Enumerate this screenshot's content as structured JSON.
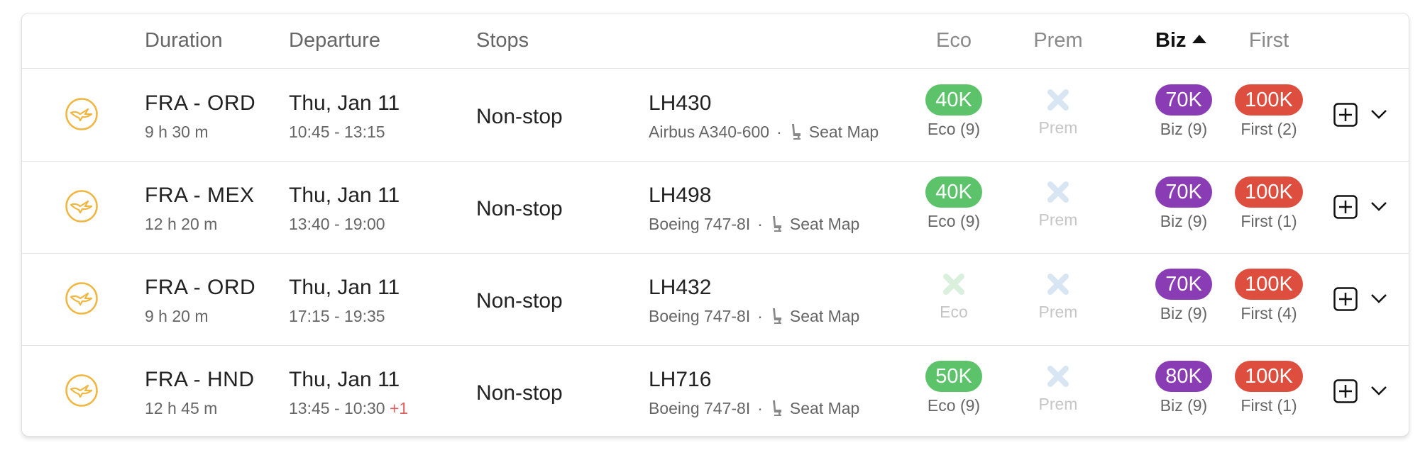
{
  "header": {
    "duration": "Duration",
    "departure": "Departure",
    "stops": "Stops",
    "eco": "Eco",
    "prem": "Prem",
    "biz": "Biz",
    "first": "First"
  },
  "colors": {
    "eco": "#5cc36b",
    "biz": "#8a3cb4",
    "first": "#de4e3e",
    "logo": "#f0b640",
    "unavailable": "#d7e6f2",
    "unavailable_eco": "#d9f0dc"
  },
  "icons": {
    "airline_logo": "lufthansa-crane-icon",
    "seat": "seat-icon",
    "add": "add-square-icon",
    "expand": "chevron-down-icon",
    "unavailable": "x-icon"
  },
  "flights": [
    {
      "route": "FRA - ORD",
      "duration": "9 h 30 m",
      "date": "Thu, Jan 11",
      "times": "10:45 - 13:15",
      "day_offset": "",
      "stops": "Non-stop",
      "flight": "LH430",
      "aircraft": "Airbus A340-600",
      "seat_map": "Seat Map",
      "eco": {
        "available": true,
        "price": "40K",
        "label": "Eco (9)"
      },
      "prem": {
        "available": false,
        "label": "Prem"
      },
      "biz": {
        "available": true,
        "price": "70K",
        "label": "Biz (9)"
      },
      "first": {
        "available": true,
        "price": "100K",
        "label": "First (2)"
      }
    },
    {
      "route": "FRA - MEX",
      "duration": "12 h 20 m",
      "date": "Thu, Jan 11",
      "times": "13:40 - 19:00",
      "day_offset": "",
      "stops": "Non-stop",
      "flight": "LH498",
      "aircraft": "Boeing 747-8I",
      "seat_map": "Seat Map",
      "eco": {
        "available": true,
        "price": "40K",
        "label": "Eco (9)"
      },
      "prem": {
        "available": false,
        "label": "Prem"
      },
      "biz": {
        "available": true,
        "price": "70K",
        "label": "Biz (9)"
      },
      "first": {
        "available": true,
        "price": "100K",
        "label": "First (1)"
      }
    },
    {
      "route": "FRA - ORD",
      "duration": "9 h 20 m",
      "date": "Thu, Jan 11",
      "times": "17:15 - 19:35",
      "day_offset": "",
      "stops": "Non-stop",
      "flight": "LH432",
      "aircraft": "Boeing 747-8I",
      "seat_map": "Seat Map",
      "eco": {
        "available": false,
        "label": "Eco"
      },
      "prem": {
        "available": false,
        "label": "Prem"
      },
      "biz": {
        "available": true,
        "price": "70K",
        "label": "Biz (9)"
      },
      "first": {
        "available": true,
        "price": "100K",
        "label": "First (4)"
      }
    },
    {
      "route": "FRA - HND",
      "duration": "12 h 45 m",
      "date": "Thu, Jan 11",
      "times": "13:45 - 10:30",
      "day_offset": "+1",
      "stops": "Non-stop",
      "flight": "LH716",
      "aircraft": "Boeing 747-8I",
      "seat_map": "Seat Map",
      "eco": {
        "available": true,
        "price": "50K",
        "label": "Eco (9)"
      },
      "prem": {
        "available": false,
        "label": "Prem"
      },
      "biz": {
        "available": true,
        "price": "80K",
        "label": "Biz (9)"
      },
      "first": {
        "available": true,
        "price": "100K",
        "label": "First (1)"
      }
    }
  ]
}
